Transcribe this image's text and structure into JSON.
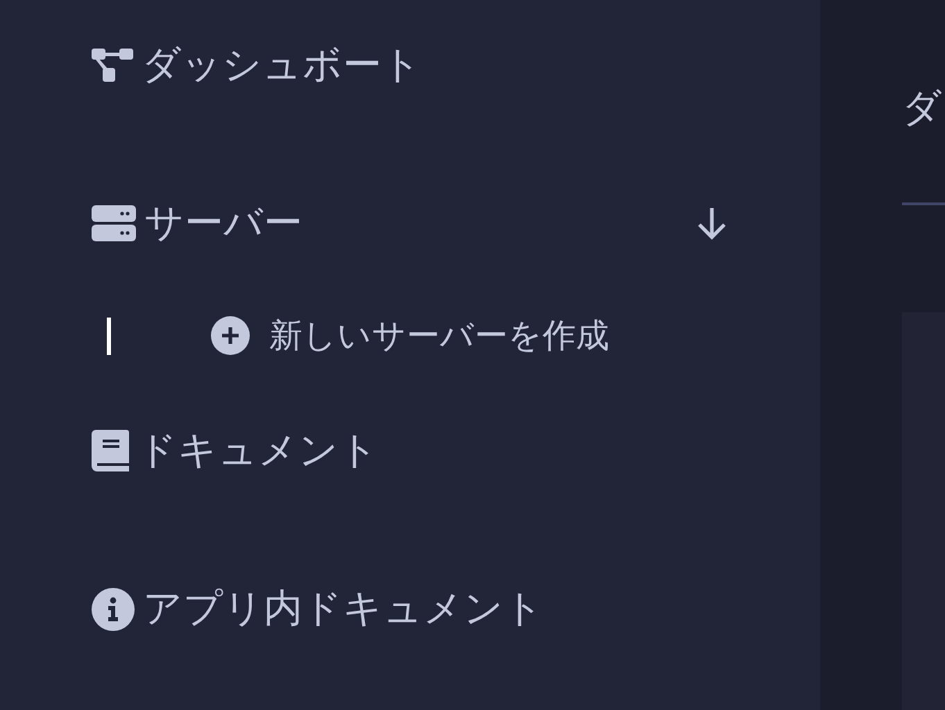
{
  "sidebar": {
    "items": [
      {
        "kind": "link",
        "label": "ダッシュボート"
      },
      {
        "kind": "group",
        "label": "サーバー",
        "expanded": true,
        "children": [
          {
            "label": "新しいサーバーを作成",
            "selected": true
          }
        ]
      },
      {
        "kind": "link",
        "label": "ドキュメント"
      },
      {
        "kind": "link",
        "label": "アプリ内ドキュメント"
      }
    ]
  },
  "main": {
    "title": "ダ"
  }
}
